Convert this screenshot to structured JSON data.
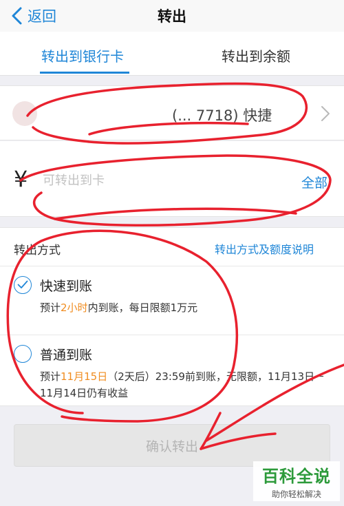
{
  "nav": {
    "back_label": "返回",
    "title": "转出"
  },
  "tabs": [
    {
      "label": "转出到银行卡",
      "active": true
    },
    {
      "label": "转出到余额",
      "active": false
    }
  ],
  "card": {
    "name": "(... 7718) 快捷"
  },
  "amount": {
    "currency_symbol": "¥",
    "placeholder": "可转出到卡",
    "all_label": "全部"
  },
  "method": {
    "section_title": "转出方式",
    "info_link": "转出方式及额度说明",
    "options": [
      {
        "title": "快速到账",
        "selected": true,
        "desc_prefix": "预计",
        "desc_highlight": "2小时",
        "desc_suffix": "内到账，每日限额1万元"
      },
      {
        "title": "普通到账",
        "selected": false,
        "desc_prefix": "预计",
        "desc_highlight": "11月15日",
        "desc_suffix": "（2天后）23:59前到账，无限额，11月13日－11月14日仍有收益"
      }
    ]
  },
  "confirm_label": "确认转出",
  "watermark": {
    "logo": "百科全说",
    "subtitle": "助你轻松解决"
  },
  "colors": {
    "accent": "#1f86d7",
    "highlight": "#f08c1f",
    "scribble": "#e8212e"
  }
}
